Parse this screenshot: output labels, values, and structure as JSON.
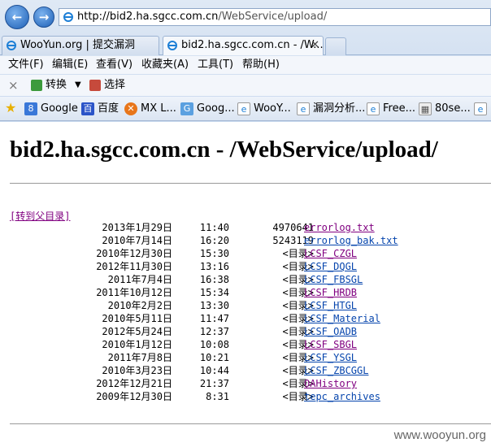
{
  "browser": {
    "url_host": "http://bid2.ha.sgcc.com.cn",
    "url_path": "/WebService/upload/",
    "tabs": [
      {
        "label": "WooYun.org | 提交漏洞"
      },
      {
        "label": "bid2.ha.sgcc.com.cn - /W..."
      }
    ],
    "menu": [
      "文件(F)",
      "编辑(E)",
      "查看(V)",
      "收藏夹(A)",
      "工具(T)",
      "帮助(H)"
    ],
    "commands": {
      "close": "×",
      "convert": "转换",
      "select": "选择"
    },
    "favorites": [
      "Google",
      "百度",
      "MX L...",
      "Goog...",
      "WooY...",
      "漏洞分析...",
      "Free...",
      "80se..."
    ]
  },
  "page": {
    "title": "bid2.ha.sgcc.com.cn - /WebService/upload/",
    "parent_link": "[转到父目录]",
    "entries": [
      {
        "date": "2013年1月29日",
        "time": "11:40",
        "size": "4970641",
        "name": "errorlog.txt",
        "visited": true
      },
      {
        "date": "2010年7月14日",
        "time": "16:20",
        "size": "5243119",
        "name": "errorlog_bak.txt",
        "visited": false
      },
      {
        "date": "2010年12月30日",
        "time": "15:30",
        "size": "<目录>",
        "name": "LCSF_CZGL",
        "visited": true
      },
      {
        "date": "2012年11月30日",
        "time": "13:16",
        "size": "<目录>",
        "name": "LCSF_DQGL",
        "visited": false
      },
      {
        "date": "2011年7月4日",
        "time": "16:38",
        "size": "<目录>",
        "name": "LCSF_FBSGL",
        "visited": false
      },
      {
        "date": "2011年10月12日",
        "time": "15:34",
        "size": "<目录>",
        "name": "LCSF_HRDB",
        "visited": true
      },
      {
        "date": "2010年2月2日",
        "time": "13:30",
        "size": "<目录>",
        "name": "LCSF_HTGL",
        "visited": false
      },
      {
        "date": "2010年5月11日",
        "time": "11:47",
        "size": "<目录>",
        "name": "LCSF_Material",
        "visited": false
      },
      {
        "date": "2012年5月24日",
        "time": "12:37",
        "size": "<目录>",
        "name": "LCSF_OADB",
        "visited": false
      },
      {
        "date": "2010年1月12日",
        "time": "10:08",
        "size": "<目录>",
        "name": "LCSF_SBGL",
        "visited": true
      },
      {
        "date": "2011年7月8日",
        "time": "10:21",
        "size": "<目录>",
        "name": "LCSF_YSGL",
        "visited": false
      },
      {
        "date": "2010年3月23日",
        "time": "10:44",
        "size": "<目录>",
        "name": "LCSF_ZBCGGL",
        "visited": false
      },
      {
        "date": "2012年12月21日",
        "time": "21:37",
        "size": "<目录>",
        "name": "OAHistory",
        "visited": true
      },
      {
        "date": "2009年12月30日",
        "time": "8:31",
        "size": "<目录>",
        "name": "tepc_archives",
        "visited": false
      }
    ]
  },
  "watermark": "www.wooyun.org",
  "colors": {
    "visited_link": "#800080",
    "link": "#0645ad",
    "ie_blue": "#1d5fb5"
  },
  "icons": [
    "back-arrow-icon",
    "forward-arrow-icon",
    "ie-logo-icon",
    "star-icon"
  ]
}
